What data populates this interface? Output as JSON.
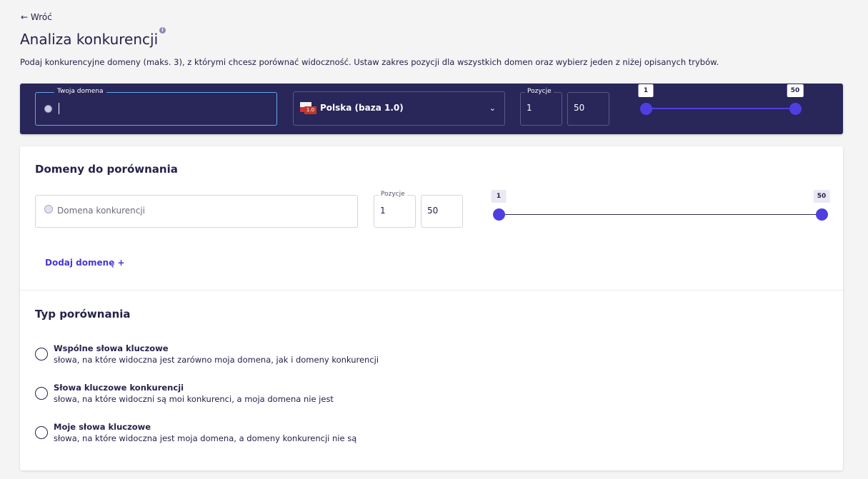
{
  "nav": {
    "back_label": "← Wróć"
  },
  "header": {
    "title": "Analiza konkurencji",
    "info_icon": "i",
    "description": "Podaj konkurencyjne domeny (maks. 3), z którymi chcesz porównać widoczność. Ustaw zakres pozycji dla wszystkich domen oraz wybierz jeden z niżej opisanych trybów."
  },
  "own_domain": {
    "legend": "Twoja domena",
    "value": "",
    "country": {
      "label": "Polska (baza 1.0)",
      "badge": "1.0",
      "icon": "chevron-down-icon"
    },
    "positions_legend": "Pozycje",
    "pos_from": "1",
    "pos_to": "50",
    "slider": {
      "min_label": "1",
      "max_label": "50",
      "from": 1,
      "to": 50,
      "min": 1,
      "max": 50
    }
  },
  "compare": {
    "title": "Domeny do porównania",
    "placeholder": "Domena konkurencji",
    "positions_legend": "Pozycje",
    "pos_from": "1",
    "pos_to": "50",
    "slider": {
      "min_label": "1",
      "max_label": "50",
      "from": 1,
      "to": 50,
      "min": 1,
      "max": 50
    },
    "add_label": "Dodaj domenę +"
  },
  "type": {
    "title": "Typ porównania",
    "options": [
      {
        "title": "Wspólne słowa kluczowe",
        "desc": "słowa, na które widoczna jest zarówno moja domena, jak i domeny konkurencji"
      },
      {
        "title": "Słowa kluczowe konkurencji",
        "desc": "słowa, na które widoczni są moi konkurenci, a moja domena nie jest"
      },
      {
        "title": "Moje słowa kluczowe",
        "desc": "słowa, na które widoczna jest moja domena, a domeny konkurencji nie są"
      }
    ]
  },
  "colors": {
    "primary": "#4f3fe0",
    "dark_bar": "#29265a",
    "text": "#25224a"
  }
}
